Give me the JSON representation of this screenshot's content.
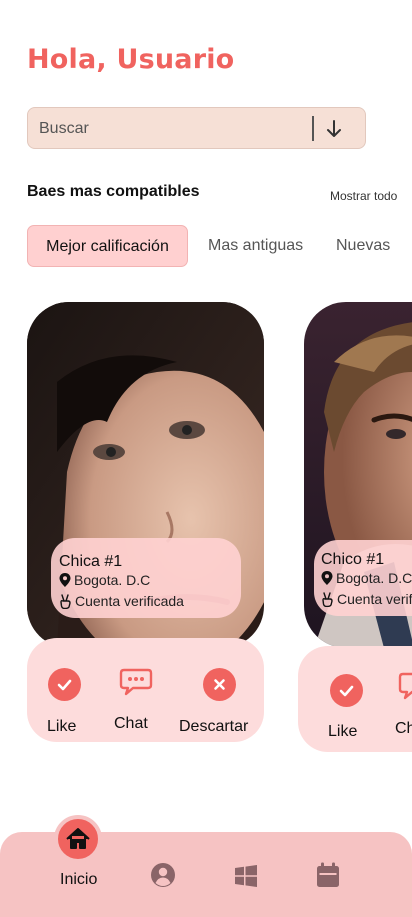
{
  "header": {
    "greeting": "Hola, Usuario"
  },
  "search": {
    "placeholder": "Buscar",
    "arrow_icon": "arrow-down-icon"
  },
  "section": {
    "title": "Baes mas compatibles",
    "show_all": "Mostrar todo"
  },
  "filters": [
    {
      "label": "Mejor calificación",
      "active": true
    },
    {
      "label": "Mas antiguas",
      "active": false
    },
    {
      "label": "Nuevas",
      "active": false
    }
  ],
  "cards": [
    {
      "name": "Chica #1",
      "location": "Bogota. D.C",
      "verified": "Cuenta verificada",
      "actions": {
        "like": "Like",
        "chat": "Chat",
        "discard": "Descartar"
      }
    },
    {
      "name": "Chico #1",
      "location": "Bogota. D.C",
      "verified": "Cuenta verificada",
      "actions": {
        "like": "Like",
        "chat": "Chat"
      }
    }
  ],
  "nav": {
    "home_label": "Inicio",
    "items": [
      "home-icon",
      "profile-icon",
      "windows-icon",
      "calendar-icon"
    ]
  },
  "colors": {
    "accent": "#f0635f",
    "search_bg": "#f6e0d6",
    "chip_bg": "#ffd0d0",
    "card_actions_bg": "#fddcdc",
    "navbar_bg": "#f6c3c3"
  }
}
